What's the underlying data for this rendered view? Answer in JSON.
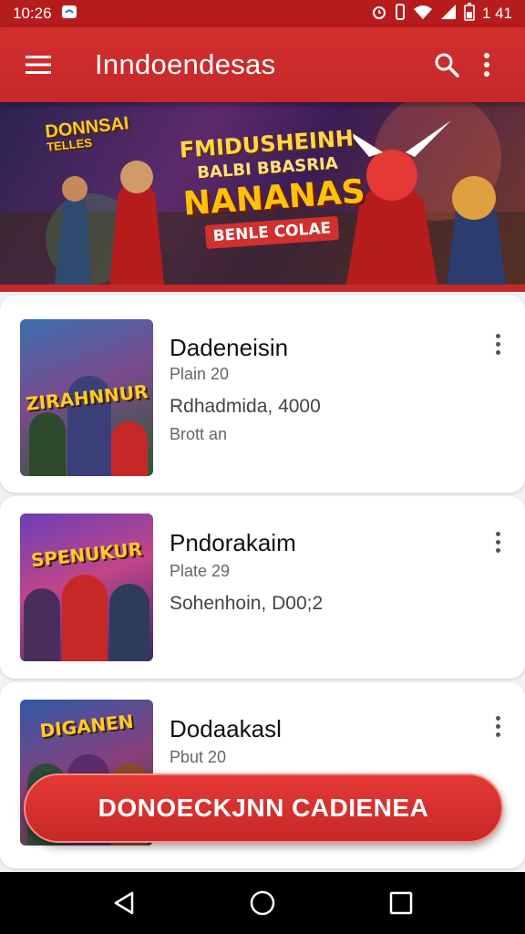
{
  "status_bar": {
    "time": "10:26",
    "battery": "1 41"
  },
  "app_bar": {
    "title": "Inndoendesas"
  },
  "banner": {
    "logo_line1": "DONNSAI",
    "logo_line2": "TELLES",
    "headline1": "FMIDUSHEINH",
    "headline2": "BALBI BBASRIA",
    "headline3": "NANANAS",
    "tag": "BENLE COLAE"
  },
  "cards": [
    {
      "title": "Dadeneisin",
      "meta": "Plain 20",
      "info": "Rdhadmida, 4000",
      "extra": "Brott an",
      "thumb_label": "ZIRAHNNUR"
    },
    {
      "title": "Pndorakaim",
      "meta": "Plate 29",
      "info": "Sohenhoin, D00;2",
      "extra": "",
      "thumb_label": "SPENUKUR"
    },
    {
      "title": "Dodaakasl",
      "meta": "Pbut 20",
      "info": "",
      "extra": "",
      "thumb_label": "DIGANEN"
    }
  ],
  "cta": {
    "label": "DONOECKJNN CADIENEA"
  },
  "colors": {
    "primary": "#c62828",
    "accent": "#e53935",
    "nav": "#000000"
  },
  "icons": [
    "menu-icon",
    "search-icon",
    "more-vert-icon",
    "back-icon",
    "home-icon",
    "recents-icon"
  ]
}
